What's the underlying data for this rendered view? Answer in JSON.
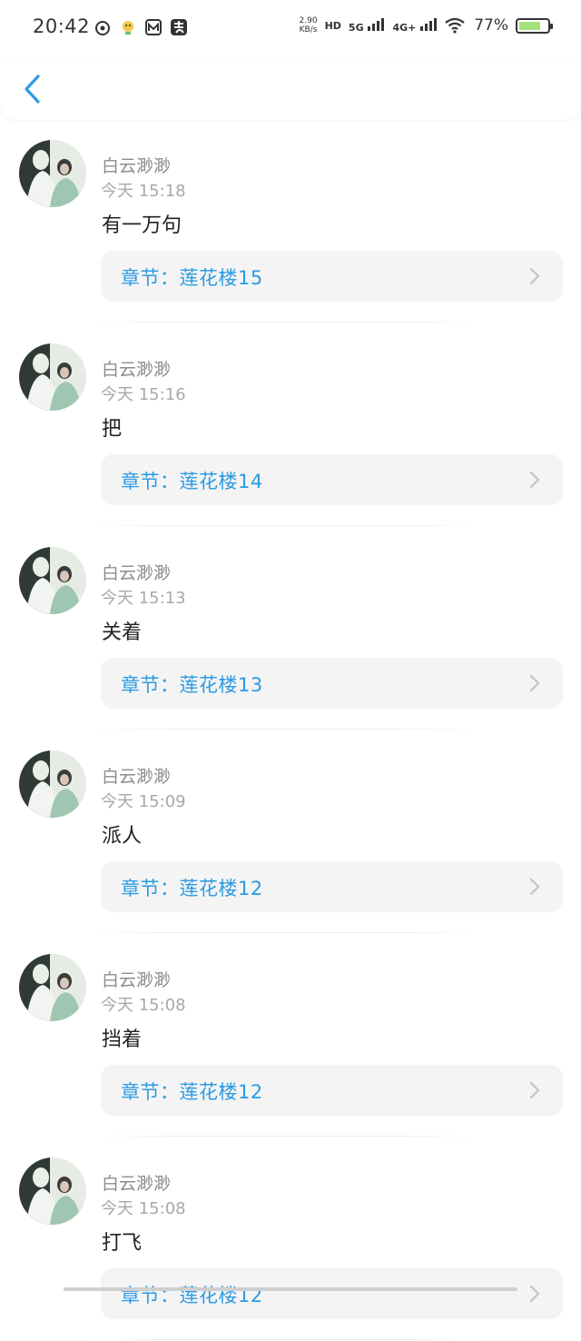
{
  "status_bar": {
    "time": "20:42",
    "left_icons": [
      "weibo-icon",
      "face-icon",
      "m-icon",
      "alipay-icon"
    ],
    "net_speed_value": "2.90",
    "net_speed_unit": "KB/s",
    "hd_label": "HD",
    "sim1": "5G",
    "sim2": "4G+",
    "battery_text": "77%",
    "battery_level": 0.77,
    "battery_color": "#a8e27a"
  },
  "nav": {
    "back_icon": "chevron-left-icon",
    "accent": "#2b9be3"
  },
  "comments": [
    {
      "user": "白云渺渺",
      "time": "今天 15:18",
      "content": "有一万句",
      "chapter": "章节：莲花楼15"
    },
    {
      "user": "白云渺渺",
      "time": "今天 15:16",
      "content": "把",
      "chapter": "章节：莲花楼14"
    },
    {
      "user": "白云渺渺",
      "time": "今天 15:13",
      "content": "关着",
      "chapter": "章节：莲花楼13"
    },
    {
      "user": "白云渺渺",
      "time": "今天 15:09",
      "content": "派人",
      "chapter": "章节：莲花楼12"
    },
    {
      "user": "白云渺渺",
      "time": "今天 15:08",
      "content": "挡着",
      "chapter": "章节：莲花楼12"
    },
    {
      "user": "白云渺渺",
      "time": "今天 15:08",
      "content": "打飞",
      "chapter": "章节：莲花楼12"
    }
  ]
}
